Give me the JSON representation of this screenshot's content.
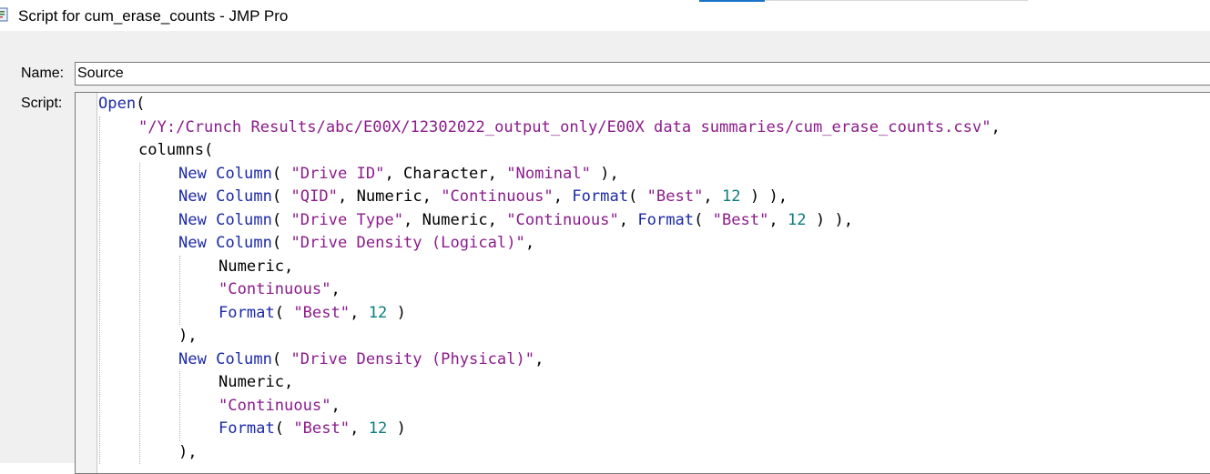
{
  "window": {
    "title": "Script for cum_erase_counts - JMP Pro",
    "icon": "jmp-script-icon"
  },
  "form": {
    "name_label": "Name:",
    "name_value": "Source",
    "script_label": "Script:"
  },
  "script": {
    "lines": [
      {
        "indent": 0,
        "tokens": [
          [
            "kw",
            "Open"
          ],
          [
            "plain",
            "("
          ]
        ]
      },
      {
        "indent": 1,
        "tokens": [
          [
            "str",
            "\"/Y:/Crunch Results/abc/E00X/12302022_output_only/E00X data summaries/cum_erase_counts.csv\""
          ],
          [
            "plain",
            ","
          ]
        ]
      },
      {
        "indent": 1,
        "tokens": [
          [
            "plain",
            "columns("
          ]
        ]
      },
      {
        "indent": 2,
        "tokens": [
          [
            "kw",
            "New Column"
          ],
          [
            "plain",
            "( "
          ],
          [
            "str",
            "\"Drive ID\""
          ],
          [
            "plain",
            ", Character, "
          ],
          [
            "str",
            "\"Nominal\""
          ],
          [
            "plain",
            " ),"
          ]
        ]
      },
      {
        "indent": 2,
        "tokens": [
          [
            "kw",
            "New Column"
          ],
          [
            "plain",
            "( "
          ],
          [
            "str",
            "\"QID\""
          ],
          [
            "plain",
            ", Numeric, "
          ],
          [
            "str",
            "\"Continuous\""
          ],
          [
            "plain",
            ", "
          ],
          [
            "kw",
            "Format"
          ],
          [
            "plain",
            "( "
          ],
          [
            "str",
            "\"Best\""
          ],
          [
            "plain",
            ", "
          ],
          [
            "num",
            "12"
          ],
          [
            "plain",
            " ) ),"
          ]
        ]
      },
      {
        "indent": 2,
        "tokens": [
          [
            "kw",
            "New Column"
          ],
          [
            "plain",
            "( "
          ],
          [
            "str",
            "\"Drive Type\""
          ],
          [
            "plain",
            ", Numeric, "
          ],
          [
            "str",
            "\"Continuous\""
          ],
          [
            "plain",
            ", "
          ],
          [
            "kw",
            "Format"
          ],
          [
            "plain",
            "( "
          ],
          [
            "str",
            "\"Best\""
          ],
          [
            "plain",
            ", "
          ],
          [
            "num",
            "12"
          ],
          [
            "plain",
            " ) ),"
          ]
        ]
      },
      {
        "indent": 2,
        "tokens": [
          [
            "kw",
            "New Column"
          ],
          [
            "plain",
            "( "
          ],
          [
            "str",
            "\"Drive Density (Logical)\""
          ],
          [
            "plain",
            ","
          ]
        ]
      },
      {
        "indent": 3,
        "tokens": [
          [
            "plain",
            "Numeric,"
          ]
        ]
      },
      {
        "indent": 3,
        "tokens": [
          [
            "str",
            "\"Continuous\""
          ],
          [
            "plain",
            ","
          ]
        ]
      },
      {
        "indent": 3,
        "tokens": [
          [
            "kw",
            "Format"
          ],
          [
            "plain",
            "( "
          ],
          [
            "str",
            "\"Best\""
          ],
          [
            "plain",
            ", "
          ],
          [
            "num",
            "12"
          ],
          [
            "plain",
            " )"
          ]
        ]
      },
      {
        "indent": 2,
        "tokens": [
          [
            "plain",
            "),"
          ]
        ]
      },
      {
        "indent": 2,
        "tokens": [
          [
            "kw",
            "New Column"
          ],
          [
            "plain",
            "( "
          ],
          [
            "str",
            "\"Drive Density (Physical)\""
          ],
          [
            "plain",
            ","
          ]
        ]
      },
      {
        "indent": 3,
        "tokens": [
          [
            "plain",
            "Numeric,"
          ]
        ]
      },
      {
        "indent": 3,
        "tokens": [
          [
            "str",
            "\"Continuous\""
          ],
          [
            "plain",
            ","
          ]
        ]
      },
      {
        "indent": 3,
        "tokens": [
          [
            "kw",
            "Format"
          ],
          [
            "plain",
            "( "
          ],
          [
            "str",
            "\"Best\""
          ],
          [
            "plain",
            ", "
          ],
          [
            "num",
            "12"
          ],
          [
            "plain",
            " )"
          ]
        ]
      },
      {
        "indent": 2,
        "tokens": [
          [
            "plain",
            "),"
          ]
        ]
      }
    ]
  },
  "colors": {
    "keyword": "#1c2aa6",
    "string": "#8b1c8b",
    "number": "#0b7c7c",
    "accent": "#1a73c8"
  }
}
